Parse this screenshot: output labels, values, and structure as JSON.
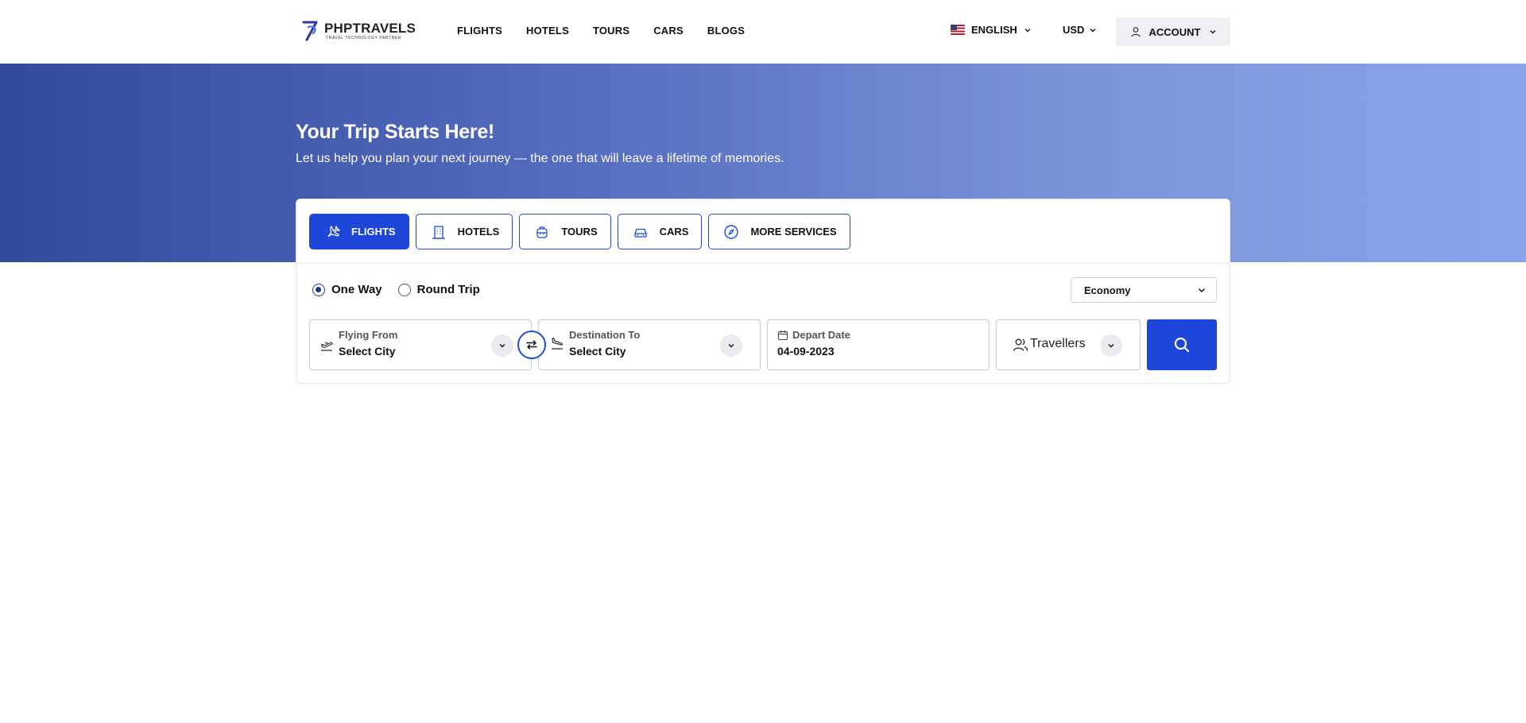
{
  "brand": {
    "name": "PHPTRAVELS",
    "tagline": "TRAVEL TECHNOLOGY PARTNER"
  },
  "nav": [
    "FLIGHTS",
    "HOTELS",
    "TOURS",
    "CARS",
    "BLOGS"
  ],
  "header": {
    "language": "ENGLISH",
    "currency": "USD",
    "account": "ACCOUNT"
  },
  "hero": {
    "title": "Your Trip Starts Here!",
    "subtitle": "Let us help you plan your next journey — the one that will leave a lifetime of memories."
  },
  "tabs": [
    {
      "label": "FLIGHTS",
      "icon": "plane-icon",
      "active": true
    },
    {
      "label": "HOTELS",
      "icon": "building-icon",
      "active": false
    },
    {
      "label": "TOURS",
      "icon": "luggage-icon",
      "active": false
    },
    {
      "label": "CARS",
      "icon": "car-icon",
      "active": false
    },
    {
      "label": "MORE SERVICES",
      "icon": "compass-icon",
      "active": false
    }
  ],
  "trip_type": {
    "options": [
      "One Way",
      "Round Trip"
    ],
    "selected": "One Way"
  },
  "cabin_class": "Economy",
  "fields": {
    "from": {
      "label": "Flying From",
      "value": "Select City"
    },
    "to": {
      "label": "Destination To",
      "value": "Select City"
    },
    "depart": {
      "label": "Depart Date",
      "value": "04-09-2023"
    },
    "travellers": {
      "label": "Travellers"
    }
  },
  "colors": {
    "primary": "#1e46d9",
    "hero_start": "#33499a",
    "hero_end": "#8ba3eb"
  }
}
